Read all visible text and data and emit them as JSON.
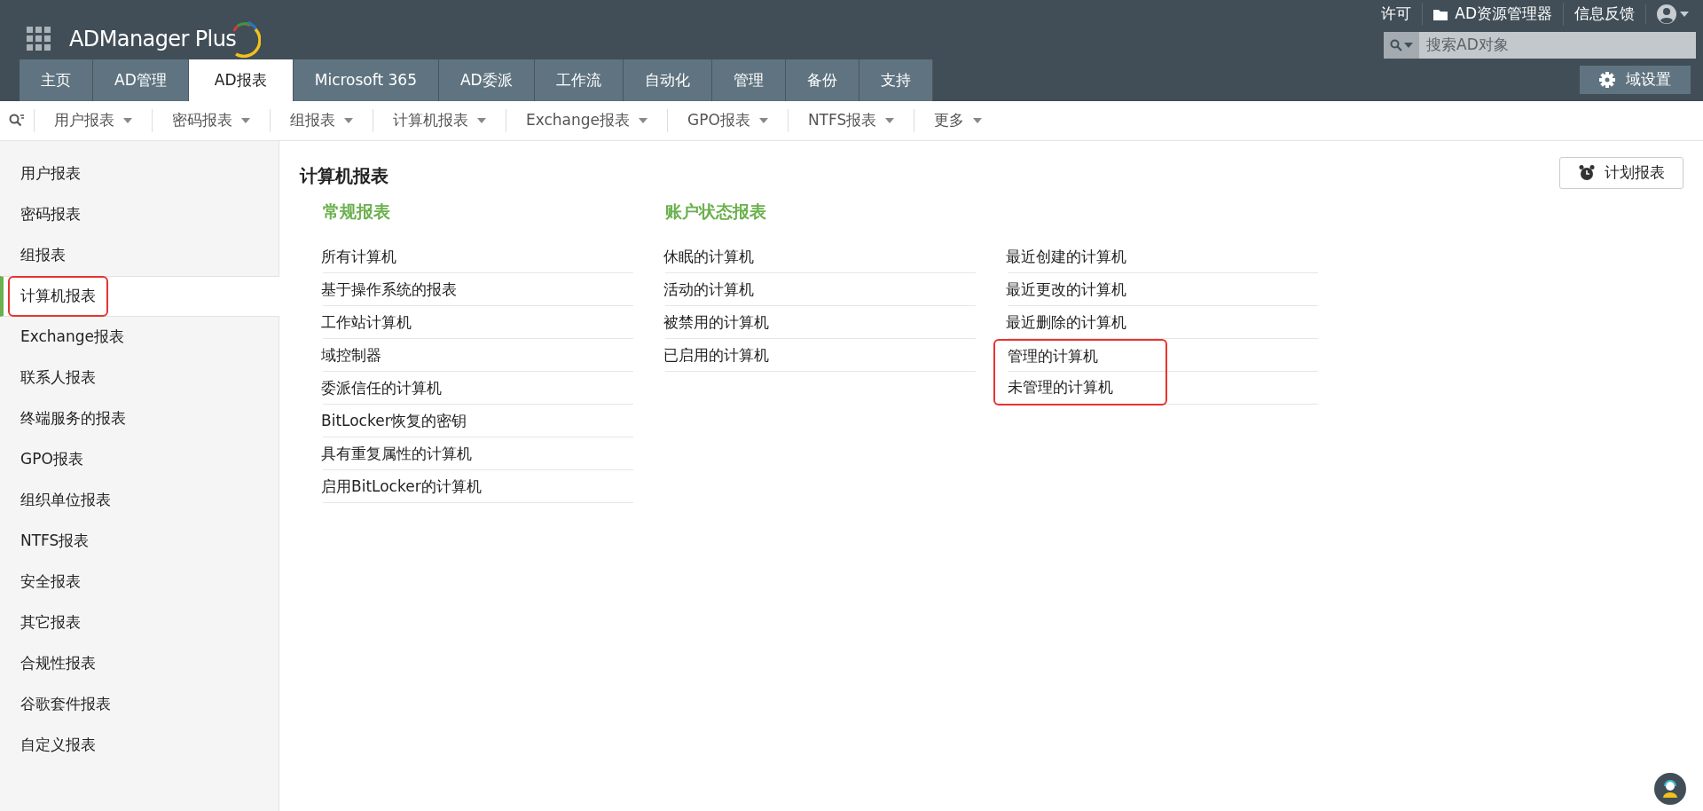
{
  "header": {
    "product": "ADManager Plus",
    "top_links": [
      {
        "kind": "text",
        "label": "许可"
      },
      {
        "kind": "folder",
        "label": "AD资源管理器"
      },
      {
        "kind": "text",
        "label": "信息反馈"
      },
      {
        "kind": "user"
      }
    ],
    "search": {
      "placeholder": "搜索AD对象"
    },
    "settings_button": "域设置"
  },
  "tabs": [
    {
      "label": "主页",
      "selected": false
    },
    {
      "label": "AD管理",
      "selected": false
    },
    {
      "label": "AD报表",
      "selected": true
    },
    {
      "label": "Microsoft 365",
      "selected": false
    },
    {
      "label": "AD委派",
      "selected": false
    },
    {
      "label": "工作流",
      "selected": false
    },
    {
      "label": "自动化",
      "selected": false
    },
    {
      "label": "管理",
      "selected": false
    },
    {
      "label": "备份",
      "selected": false
    },
    {
      "label": "支持",
      "selected": false
    }
  ],
  "subnav": [
    "用户报表",
    "密码报表",
    "组报表",
    "计算机报表",
    "Exchange报表",
    "GPO报表",
    "NTFS报表",
    "更多"
  ],
  "sidebar": {
    "items": [
      {
        "label": "用户报表",
        "selected": false,
        "highlighted": false
      },
      {
        "label": "密码报表",
        "selected": false,
        "highlighted": false
      },
      {
        "label": "组报表",
        "selected": false,
        "highlighted": false
      },
      {
        "label": "计算机报表",
        "selected": true,
        "highlighted": true
      },
      {
        "label": "Exchange报表",
        "selected": false,
        "highlighted": false
      },
      {
        "label": "联系人报表",
        "selected": false,
        "highlighted": false
      },
      {
        "label": "终端服务的报表",
        "selected": false,
        "highlighted": false
      },
      {
        "label": "GPO报表",
        "selected": false,
        "highlighted": false
      },
      {
        "label": "组织单位报表",
        "selected": false,
        "highlighted": false
      },
      {
        "label": "NTFS报表",
        "selected": false,
        "highlighted": false
      },
      {
        "label": "安全报表",
        "selected": false,
        "highlighted": false
      },
      {
        "label": "其它报表",
        "selected": false,
        "highlighted": false
      },
      {
        "label": "合规性报表",
        "selected": false,
        "highlighted": false
      },
      {
        "label": "谷歌套件报表",
        "selected": false,
        "highlighted": false
      },
      {
        "label": "自定义报表",
        "selected": false,
        "highlighted": false
      }
    ]
  },
  "content": {
    "title": "计算机报表",
    "schedule_button": "计划报表",
    "columns": [
      {
        "heading": "常规报表",
        "items": [
          {
            "label": "所有计算机",
            "highlighted": false
          },
          {
            "label": "基于操作系统的报表",
            "highlighted": false
          },
          {
            "label": "工作站计算机",
            "highlighted": false
          },
          {
            "label": "域控制器",
            "highlighted": false
          },
          {
            "label": "委派信任的计算机",
            "highlighted": false
          },
          {
            "label": "BitLocker恢复的密钥",
            "highlighted": false
          },
          {
            "label": "具有重复属性的计算机",
            "highlighted": false
          },
          {
            "label": "启用BitLocker的计算机",
            "highlighted": false
          }
        ]
      },
      {
        "heading": "账户状态报表",
        "items": [
          {
            "label": "休眠的计算机",
            "highlighted": false
          },
          {
            "label": "活动的计算机",
            "highlighted": false
          },
          {
            "label": "被禁用的计算机",
            "highlighted": false
          },
          {
            "label": "已启用的计算机",
            "highlighted": false
          }
        ]
      },
      {
        "items": [
          {
            "label": "最近创建的计算机",
            "highlighted": false
          },
          {
            "label": "最近更改的计算机",
            "highlighted": false
          },
          {
            "label": "最近删除的计算机",
            "highlighted": false
          },
          {
            "label": "管理的计算机",
            "highlighted": true
          },
          {
            "label": "未管理的计算机",
            "highlighted": true
          }
        ]
      }
    ]
  }
}
